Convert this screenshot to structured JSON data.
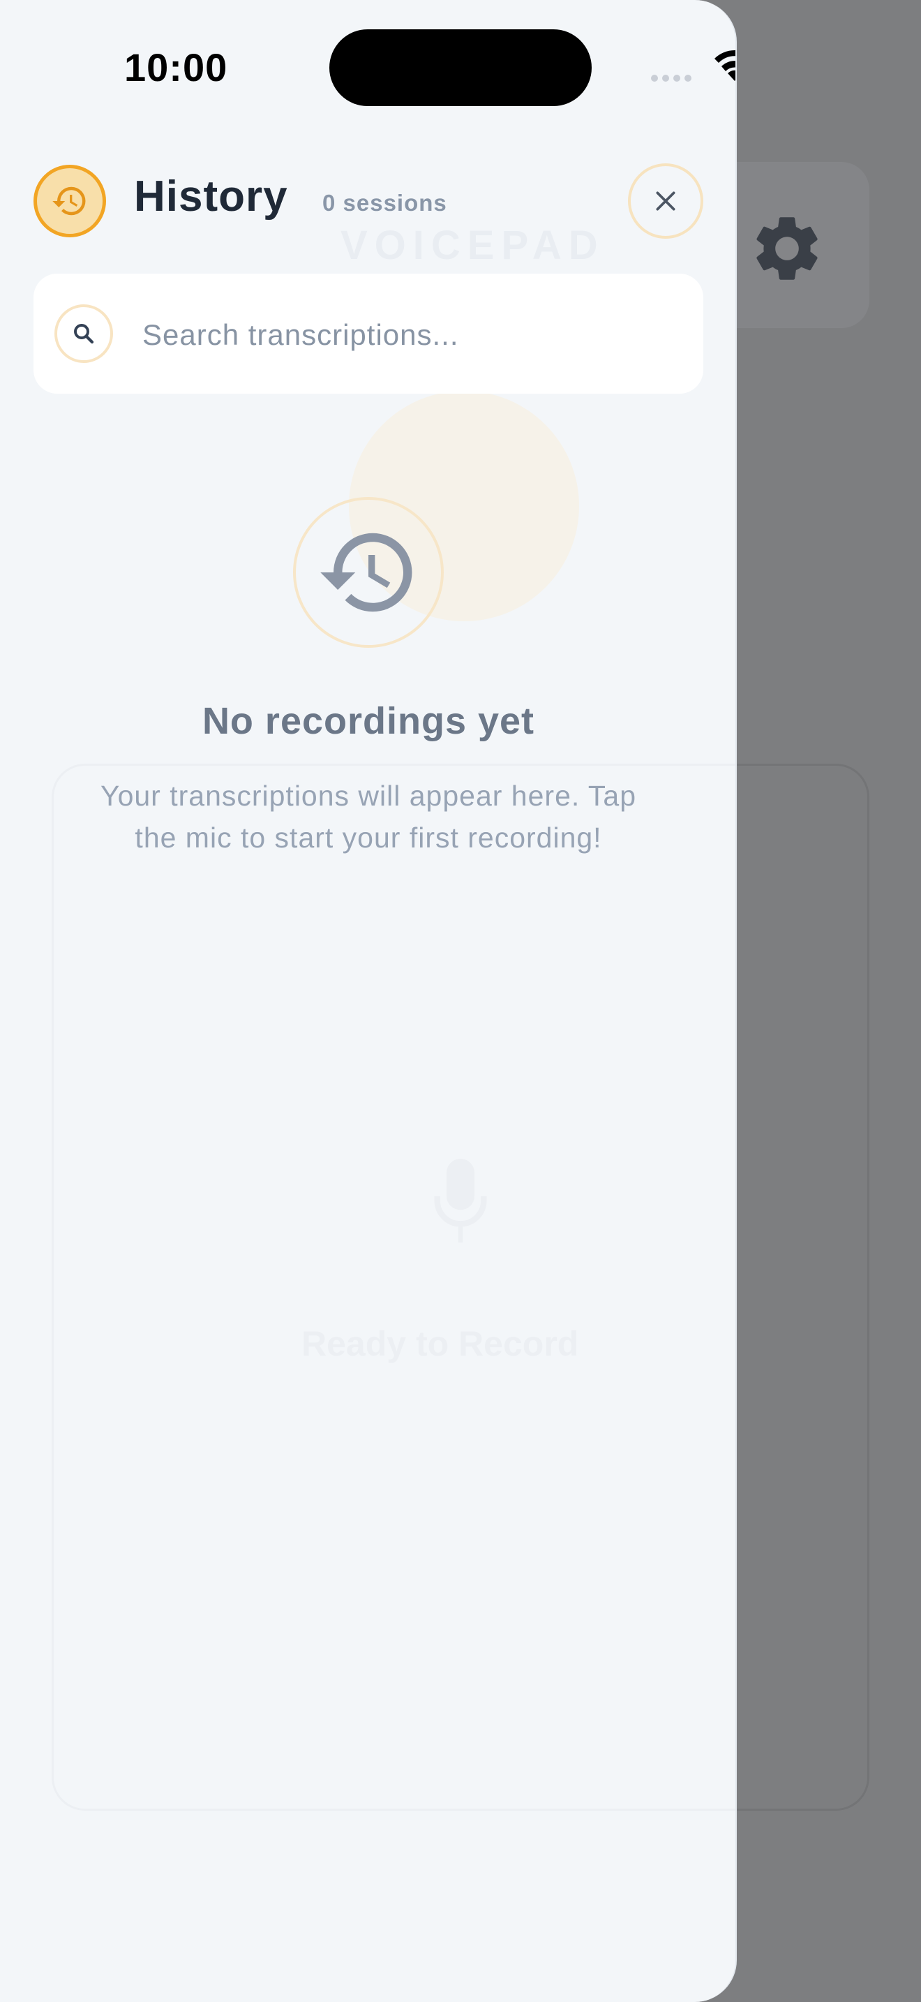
{
  "status_bar": {
    "time": "10:00"
  },
  "drawer": {
    "title": "History",
    "session_count": "0 sessions",
    "search": {
      "placeholder": "Search transcriptions...",
      "value": ""
    },
    "empty_state": {
      "title": "No recordings yet",
      "description": "Your transcriptions will appear here. Tap the mic to start your first recording!"
    }
  },
  "background_app": {
    "logo_text": "VOICEPAD",
    "ready_text": "Ready to Record"
  },
  "icons": {
    "header": "history-icon",
    "close": "close-icon",
    "search": "search-icon",
    "empty": "history-icon",
    "background_settings": "gear-icon"
  },
  "colors": {
    "accent": "#f2a524",
    "accent_soft": "#f8dfaa",
    "drawer_bg": "#f3f6f9",
    "title": "#1f2937",
    "muted": "#8996a8",
    "overlay": "#7d7e80"
  }
}
